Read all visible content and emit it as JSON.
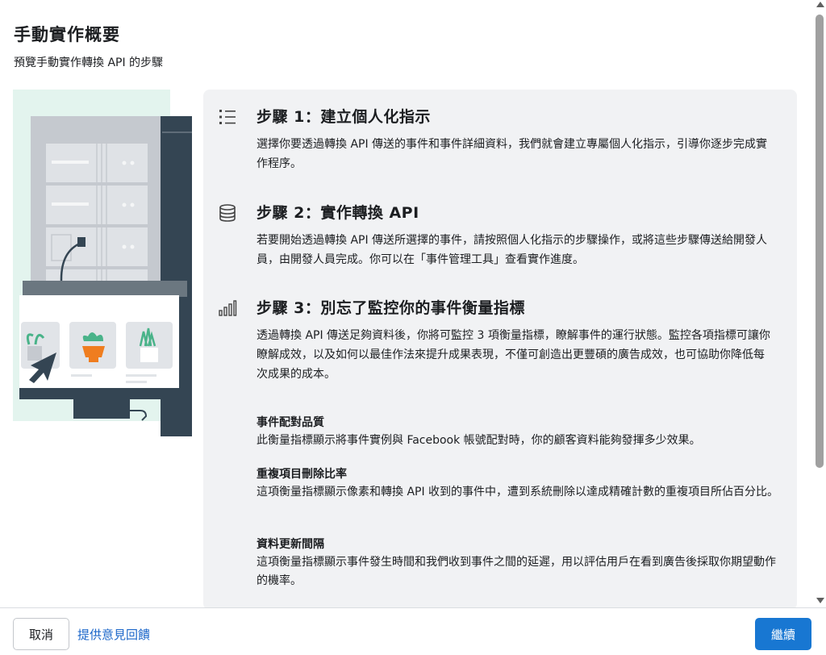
{
  "header": {
    "title": "手動實作概要",
    "subtitle": "預覽手動實作轉換 API 的步驟"
  },
  "steps": [
    {
      "icon": "list-icon",
      "title": "步驟 1：建立個人化指示",
      "description": "選擇你要透過轉換 API 傳送的事件和事件詳細資料，我們就會建立專屬個人化指示，引導你逐步完成實作程序。"
    },
    {
      "icon": "database-icon",
      "title": "步驟 2：實作轉換 API",
      "description": "若要開始透過轉換 API 傳送所選擇的事件，請按照個人化指示的步驟操作，或將這些步驟傳送給開發人員，由開發人員完成。你可以在「事件管理工具」查看實作進度。"
    },
    {
      "icon": "bar-chart-icon",
      "title": "步驟 3：別忘了監控你的事件衡量指標",
      "description": "透過轉換 API 傳送足夠資料後，你將可監控 3 項衡量指標，瞭解事件的運行狀態。監控各項指標可讓你瞭解成效，以及如何以最佳作法來提升成果表現，不僅可創造出更豐碩的廣告成效，也可協助你降低每次成果的成本。"
    }
  ],
  "metrics": [
    {
      "title": "事件配對品質",
      "description": "此衡量指標顯示將事件實例與 Facebook 帳號配對時，你的顧客資料能夠發揮多少效果。"
    },
    {
      "title": "重複項目刪除比率",
      "description": "這項衡量指標顯示像素和轉換 API 收到的事件中，遭到系統刪除以達成精確計數的重複項目所佔百分比。"
    },
    {
      "title": "資料更新間隔",
      "description": "這項衡量指標顯示事件發生時間和我們收到事件之間的延遲，用以評估用戶在看到廣告後採取你期望動作的機率。"
    }
  ],
  "footer": {
    "cancel_label": "取消",
    "feedback_label": "提供意見回饋",
    "continue_label": "繼續"
  },
  "colors": {
    "primary": "#1877d2",
    "link": "#1b66c9",
    "panel_bg": "#f1f2f4"
  }
}
